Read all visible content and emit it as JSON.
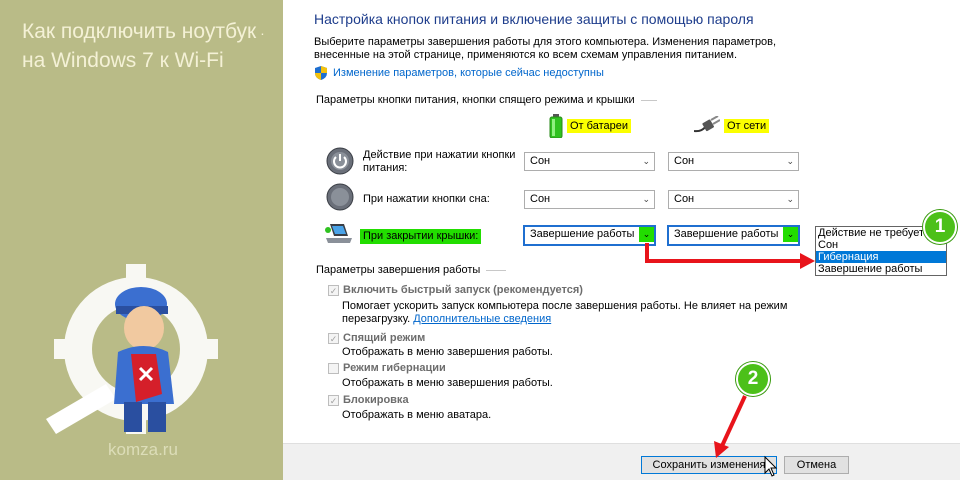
{
  "site": {
    "title_line1": "Как подключить ноутбук",
    "title_line2": "на Windows 7 к Wi-Fi",
    "domain": "komza.ru"
  },
  "page": {
    "heading": "Настройка кнопок питания и включение защиты с помощью пароля",
    "description": "Выберите параметры завершения работы для этого компьютера. Изменения параметров, внесенные на этой странице, применяются ко всем схемам управления питанием.",
    "change_link": "Изменение параметров, которые сейчас недоступны"
  },
  "buttons_section": {
    "title": "Параметры кнопки питания, кнопки спящего режима и крышки",
    "col_battery": "От батареи",
    "col_plugged": "От сети",
    "rows": [
      {
        "label": "Действие при нажатии кнопки питания:",
        "battery": "Сон",
        "plugged": "Сон"
      },
      {
        "label": "При нажатии кнопки сна:",
        "battery": "Сон",
        "plugged": "Сон"
      },
      {
        "label": "При закрытии крышки:",
        "battery": "Завершение работы",
        "plugged": "Завершение работы"
      }
    ]
  },
  "dropdown": {
    "options": [
      "Действие не требуется",
      "Сон",
      "Гибернация",
      "Завершение работы"
    ],
    "selected": "Гибернация"
  },
  "shutdown_section": {
    "title": "Параметры завершения работы",
    "fast_startup": {
      "label": "Включить быстрый запуск (рекомендуется)",
      "desc": "Помогает ускорить запуск компьютера после завершения работы. Не влияет на режим перезагрузку.",
      "link": "Дополнительные сведения",
      "checked": true
    },
    "sleep": {
      "label": "Спящий режим",
      "desc": "Отображать в меню завершения работы.",
      "checked": true
    },
    "hibernate": {
      "label": "Режим гибернации",
      "desc": "Отображать в меню завершения работы.",
      "checked": false
    },
    "lock": {
      "label": "Блокировка",
      "desc": "Отображать в меню аватара.",
      "checked": true
    }
  },
  "footer": {
    "save_label": "Сохранить изменения",
    "cancel_label": "Отмена"
  },
  "annotations": {
    "step1": "1",
    "step2": "2"
  },
  "colors": {
    "highlight_yellow": "#fbff00",
    "highlight_green": "#22dd00",
    "arrow_red": "#e8141b",
    "badge_green": "#4cc019",
    "side_panel": "#b9bb87"
  },
  "icons": {
    "check": "✓",
    "dropdown_arrow": "⌄"
  }
}
